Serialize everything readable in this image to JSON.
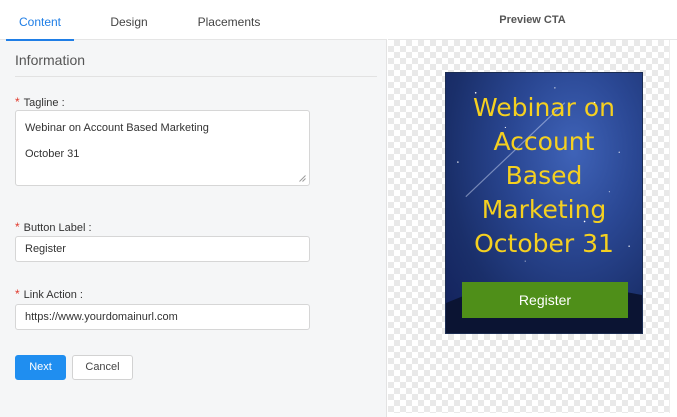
{
  "tabs": [
    {
      "label": "Content",
      "active": true
    },
    {
      "label": "Design",
      "active": false
    },
    {
      "label": "Placements",
      "active": false
    }
  ],
  "form": {
    "section_title": "Information",
    "required_marker": "*",
    "tagline_label": "Tagline :",
    "tagline_line1": "Webinar on Account Based Marketing",
    "tagline_line2": "October 31",
    "button_label_label": "Button Label :",
    "button_label_value": "Register",
    "link_action_label": "Link Action :",
    "link_action_value": "https://www.yourdomainurl.com"
  },
  "actions": {
    "next_label": "Next",
    "cancel_label": "Cancel"
  },
  "preview": {
    "header": "Preview CTA",
    "cta_lines": [
      "Webinar on",
      "Account",
      "Based",
      "Marketing",
      "October 31"
    ],
    "cta_button": "Register"
  },
  "colors": {
    "accent": "#1f7ee6",
    "primary_button": "#1f8ef0",
    "required": "#e03b2e",
    "cta_text": "#f5d020",
    "cta_button": "#4f8f19"
  }
}
